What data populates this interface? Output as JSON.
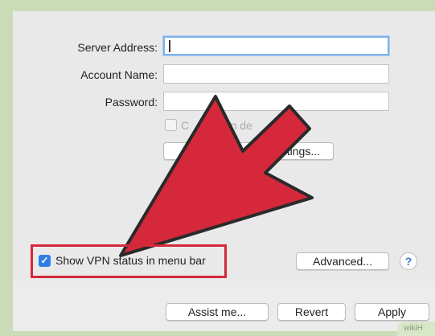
{
  "form": {
    "server_address_label": "Server Address:",
    "server_address_value": "",
    "account_name_label": "Account Name:",
    "account_name_value": "",
    "password_label": "Password:",
    "password_value": "",
    "connect_on_demand_visible": "C",
    "connect_on_demand_visible_2": "t on de",
    "auth_settings_visible": "tings..."
  },
  "options": {
    "show_vpn_status_label": "Show VPN status in menu bar",
    "show_vpn_status_checked": true,
    "advanced_label": "Advanced...",
    "help_label": "?"
  },
  "footer": {
    "assist_label": "Assist me...",
    "revert_label": "Revert",
    "apply_label": "Apply"
  },
  "annotation": {
    "arrow_color": "#d5283b",
    "highlight_color": "#d5283b"
  },
  "watermark": {
    "text": "wikiH"
  }
}
